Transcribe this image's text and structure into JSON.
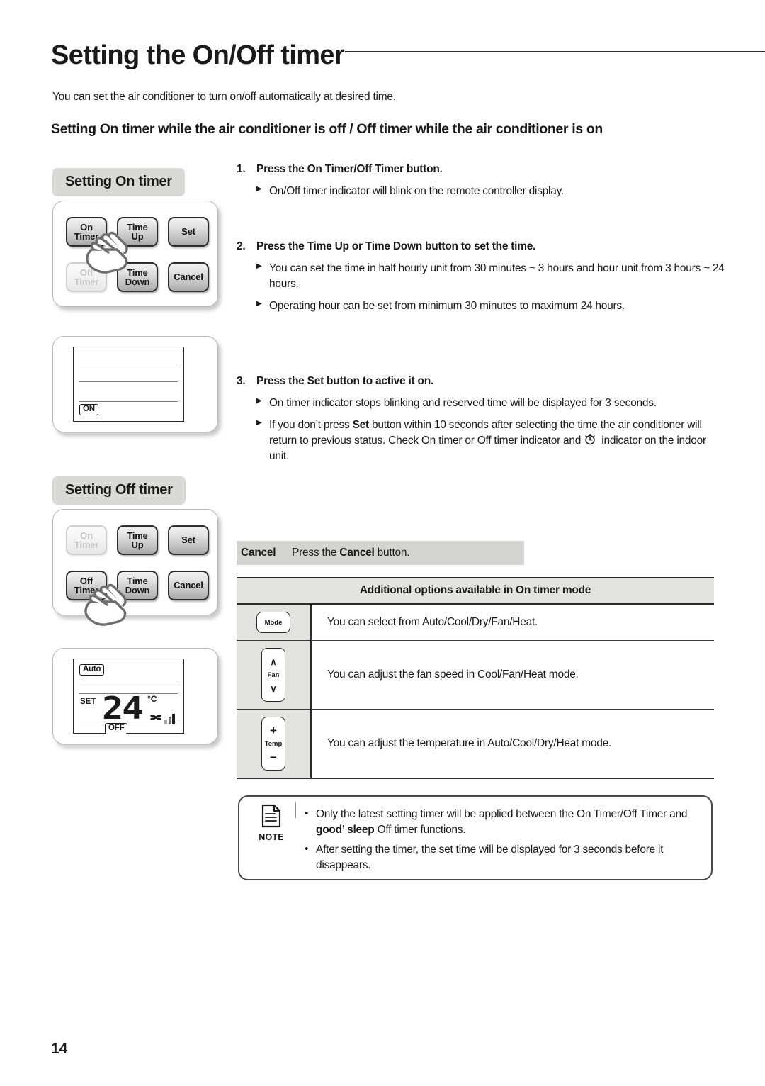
{
  "page": {
    "title": "Setting the On/Off timer",
    "intro": "You can set the air conditioner to turn on/off automatically at desired time.",
    "section_heading": "Setting On timer while the air conditioner is off / Off timer while the air conditioner is on",
    "number": "14"
  },
  "left_column": {
    "on_timer": {
      "pill_label": "Setting On timer",
      "buttons": [
        {
          "label_top": "On",
          "label_bottom": "Timer",
          "state": "active"
        },
        {
          "label_top": "Time",
          "label_bottom": "Up",
          "state": "active"
        },
        {
          "label_top": "Set",
          "label_bottom": "",
          "state": "active"
        },
        {
          "label_top": "Off",
          "label_bottom": "Timer",
          "state": "dimmed"
        },
        {
          "label_top": "Time",
          "label_bottom": "Down",
          "state": "active"
        },
        {
          "label_top": "Cancel",
          "label_bottom": "",
          "state": "active"
        }
      ],
      "pressed_button": "On Timer",
      "display": {
        "badge": "ON"
      }
    },
    "off_timer": {
      "pill_label": "Setting Off timer",
      "buttons": [
        {
          "label_top": "On",
          "label_bottom": "Timer",
          "state": "dimmed"
        },
        {
          "label_top": "Time",
          "label_bottom": "Up",
          "state": "active"
        },
        {
          "label_top": "Set",
          "label_bottom": "",
          "state": "active"
        },
        {
          "label_top": "Off",
          "label_bottom": "Timer",
          "state": "active"
        },
        {
          "label_top": "Time",
          "label_bottom": "Down",
          "state": "active"
        },
        {
          "label_top": "Cancel",
          "label_bottom": "",
          "state": "active"
        }
      ],
      "pressed_button": "Off Timer",
      "display": {
        "mode_badge": "Auto",
        "set_label": "SET",
        "temperature": "24",
        "degree_unit": "°C",
        "fan_icon": "fan-icon",
        "fan_bars": 3,
        "badge": "OFF"
      }
    }
  },
  "steps": [
    {
      "number": "1.",
      "head_prefix": "Press the ",
      "head_bold": "On Timer/Off Timer",
      "head_suffix": " button.",
      "bullets": [
        "On/Off timer indicator will blink on the remote controller display."
      ]
    },
    {
      "number": "2.",
      "head_prefix": "Press the ",
      "head_bold": "Time Up",
      "head_mid": " or ",
      "head_bold2": "Time Down",
      "head_suffix": " button to set the time.",
      "bullets": [
        "You can set the time in half hourly unit from 30 minutes ~ 3 hours and hour unit from 3 hours ~ 24 hours.",
        "Operating hour can be set from minimum 30 minutes to maximum 24 hours."
      ]
    },
    {
      "number": "3.",
      "head_prefix": "Press the ",
      "head_bold": "Set",
      "head_suffix": " button to active it on.",
      "bullets": [
        "On timer indicator stops blinking and reserved time will be displayed for 3 seconds."
      ],
      "bullet_rich": {
        "part1": "If you don’t press ",
        "bold1": "Set",
        "part2": " button within 10 seconds after selecting the time the air conditioner will return to previous status. Check On timer or Off timer indicator and ",
        "icon": "clock-icon",
        "part3": " indicator on the indoor unit."
      }
    }
  ],
  "cancel_strip": {
    "label": "Cancel",
    "text_prefix": "Press the ",
    "text_bold": "Cancel",
    "text_suffix": " button."
  },
  "options_table": {
    "header": "Additional options available in On timer mode",
    "rows": [
      {
        "button_label": "Mode",
        "icon": "mode-button-icon",
        "description": "You can select from Auto/Cool/Dry/Fan/Heat."
      },
      {
        "button_label": "Fan",
        "icon": "fan-updown-button-icon",
        "up": "∧",
        "down": "∨",
        "description": "You can adjust the fan speed in Cool/Fan/Heat mode."
      },
      {
        "button_label": "Temp",
        "icon": "temp-plusminus-button-icon",
        "up": "+",
        "down": "−",
        "description": "You can adjust the temperature in Auto/Cool/Dry/Heat mode."
      }
    ]
  },
  "note_box": {
    "label": "NOTE",
    "icon": "document-note-icon",
    "items_rich": [
      {
        "part1": "Only the latest setting timer will be applied between the On Timer/Off Timer and ",
        "bold1": "good’ sleep",
        "part2": " Off timer functions."
      },
      {
        "part1": "After setting the timer, the set time will be displayed for 3 seconds before it disappears."
      }
    ]
  },
  "colors": {
    "pill_gray": "#d9d9d7",
    "strip_gray": "#d4d4d2",
    "table_header_gray": "#e3e3e1",
    "ink": "#1a1a1a"
  }
}
